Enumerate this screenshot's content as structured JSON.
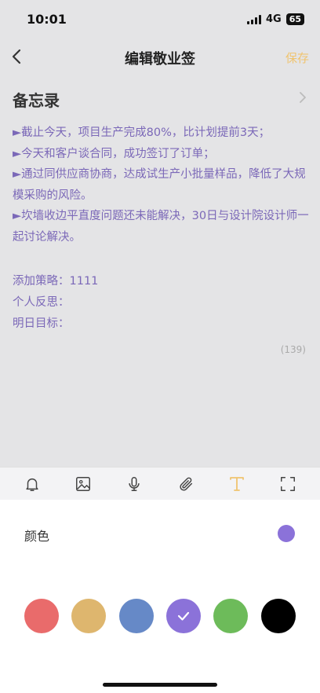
{
  "status_bar": {
    "time": "10:01",
    "network": "4G",
    "battery": "65"
  },
  "nav": {
    "title": "编辑敬业签",
    "save_label": "保存",
    "save_color": "#f0c470"
  },
  "memo": {
    "title": "备忘录",
    "lines": [
      "►截止今天，项目生产完成80%，比计划提前3天；",
      "►今天和客户谈合同，成功签订了订单；",
      "►通过同供应商协商，达成试生产小批量样品，降低了大规模采购的风险。",
      "►坎墙收边平直度问题还未能解决，30日与设计院设计师一起讨论解决。"
    ],
    "fields": [
      "添加策略：1111",
      "个人反思：",
      "明日目标："
    ],
    "char_count": "(139)",
    "text_color": "#7b68b8"
  },
  "toolbar": {
    "items": [
      {
        "icon": "bell-icon"
      },
      {
        "icon": "image-icon"
      },
      {
        "icon": "microphone-icon"
      },
      {
        "icon": "paperclip-icon"
      },
      {
        "icon": "text-format-icon",
        "active": true
      },
      {
        "icon": "fullscreen-icon"
      }
    ],
    "active_color": "#f0c470"
  },
  "color_panel": {
    "label": "颜色",
    "current_color": "#8b72d9",
    "swatches": [
      {
        "color": "#e96b6b",
        "selected": false
      },
      {
        "color": "#deb66e",
        "selected": false
      },
      {
        "color": "#6689c7",
        "selected": false
      },
      {
        "color": "#8b72d9",
        "selected": true
      },
      {
        "color": "#6dbb5a",
        "selected": false
      },
      {
        "color": "#000000",
        "selected": false
      }
    ]
  }
}
